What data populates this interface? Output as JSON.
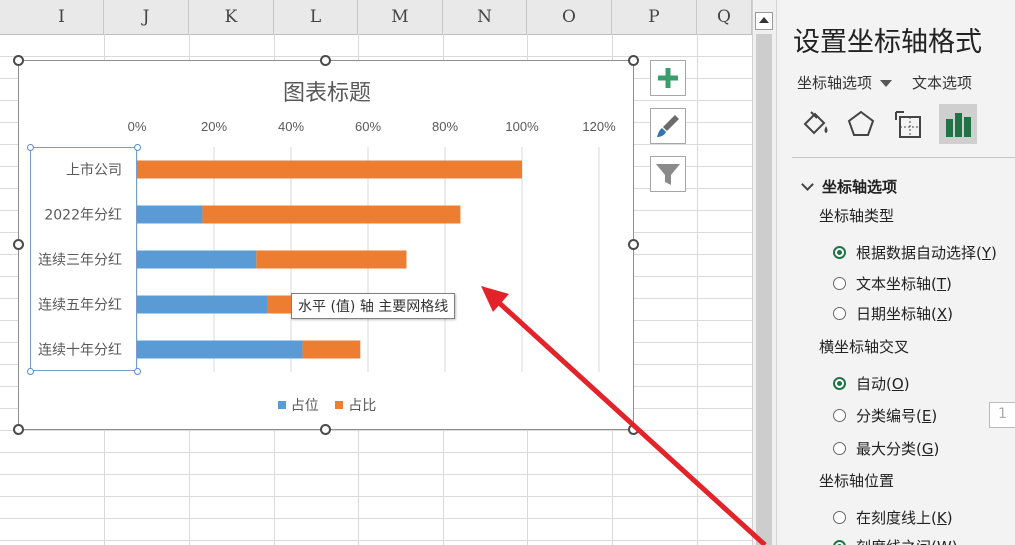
{
  "columns": [
    "I",
    "J",
    "K",
    "L",
    "M",
    "N",
    "O",
    "P",
    "Q"
  ],
  "chart": {
    "title": "图表标题",
    "tooltip": "水平 (值) 轴 主要网格线"
  },
  "chart_data": {
    "type": "bar",
    "orientation": "horizontal",
    "stacked": true,
    "title": "图表标题",
    "categories": [
      "上市公司",
      "2022年分红",
      "连续三年分红",
      "连续五年分红",
      "连续十年分红"
    ],
    "series": [
      {
        "name": "占位",
        "color": "#5b9bd5",
        "values": [
          0,
          0.17,
          0.31,
          0.34,
          0.43
        ]
      },
      {
        "name": "占比",
        "color": "#ed7d31",
        "values": [
          1.0,
          0.67,
          0.39,
          0.07,
          0.15
        ]
      }
    ],
    "xlim": [
      0,
      1.2
    ],
    "xticks": [
      "0%",
      "20%",
      "40%",
      "60%",
      "80%",
      "100%",
      "120%"
    ],
    "x_axis_position": "top",
    "grid": true,
    "legend_position": "bottom"
  },
  "panel": {
    "title": "设置坐标轴格式",
    "tab_axis_options": "坐标轴选项",
    "tab_text_options": "文本选项",
    "icons": [
      "fill-bucket-icon",
      "pentagon-icon",
      "size-properties-icon",
      "bar-chart-icon"
    ],
    "section_title": "坐标轴选项",
    "axis_type_label": "坐标轴类型",
    "axis_type_options": [
      {
        "text": "根据数据自动选择",
        "key": "Y",
        "selected": true
      },
      {
        "text": "文本坐标轴",
        "key": "T",
        "selected": false
      },
      {
        "text": "日期坐标轴",
        "key": "X",
        "selected": false
      }
    ],
    "cross_label": "横坐标轴交叉",
    "cross_options": [
      {
        "text": "自动",
        "key": "O",
        "selected": true
      },
      {
        "text": "分类编号",
        "key": "E",
        "selected": false
      },
      {
        "text": "最大分类",
        "key": "G",
        "selected": false
      }
    ],
    "spin_value": "1",
    "position_label": "坐标轴位置",
    "position_options": [
      {
        "text": "在刻度线上",
        "key": "K",
        "selected": false
      },
      {
        "text": "刻度线之间",
        "key": "W",
        "selected": true
      }
    ]
  }
}
